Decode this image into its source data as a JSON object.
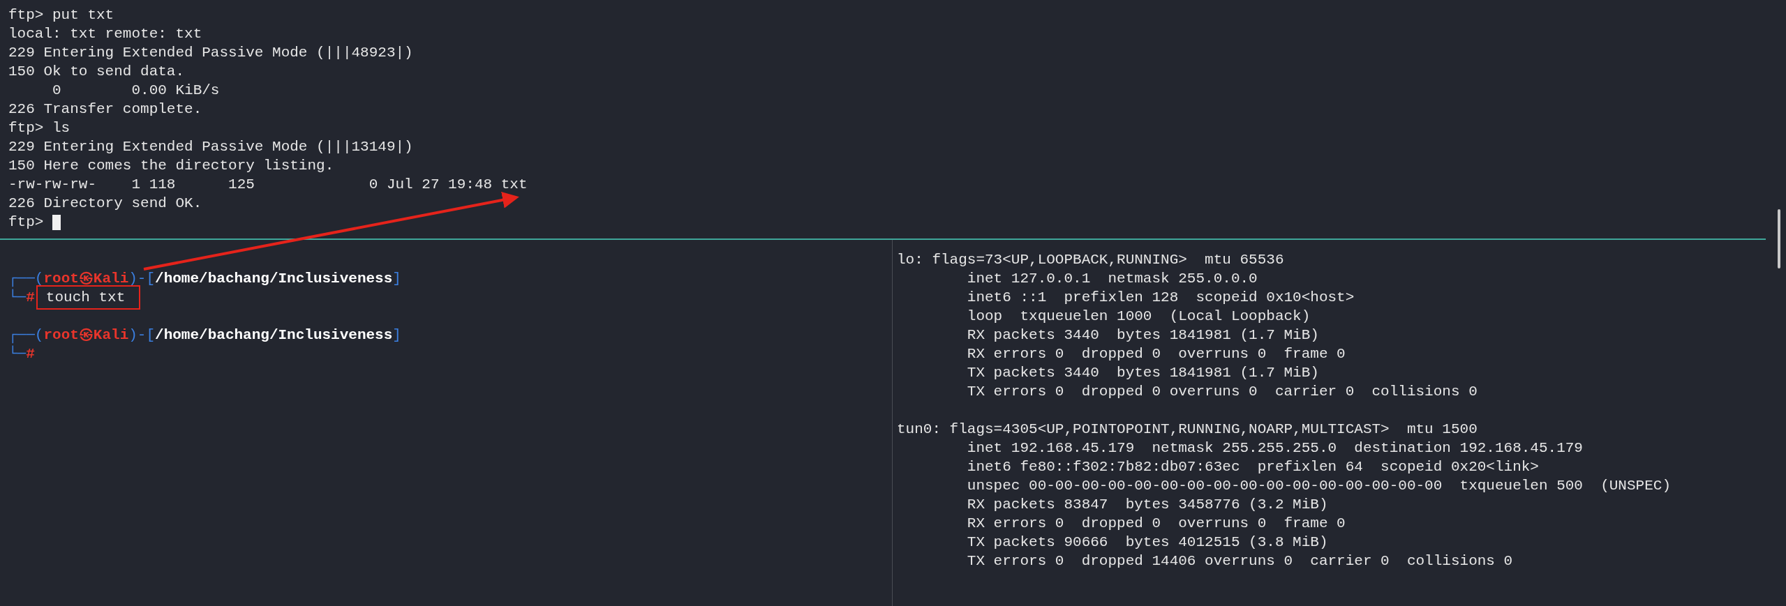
{
  "top_pane": {
    "lines": [
      "ftp> put txt",
      "local: txt remote: txt",
      "229 Entering Extended Passive Mode (|||48923|)",
      "150 Ok to send data.",
      "     0        0.00 KiB/s",
      "226 Transfer complete.",
      "ftp> ls",
      "229 Entering Extended Passive Mode (|||13149|)",
      "150 Here comes the directory listing.",
      "-rw-rw-rw-    1 118      125             0 Jul 27 19:48 txt",
      "226 Directory send OK.",
      "ftp> "
    ],
    "cursor": true
  },
  "left_pane": {
    "prompts": [
      {
        "corner_top": "┌──(",
        "user_host": "root㉿Kali",
        "bracket_open": ")-[",
        "path": "/home/bachang/Inclusiveness",
        "bracket_close": "]",
        "corner_bottom": "└─",
        "symbol": "#",
        "command": "touch txt",
        "annotated": true
      },
      {
        "corner_top": "┌──(",
        "user_host": "root㉿Kali",
        "bracket_open": ")-[",
        "path": "/home/bachang/Inclusiveness",
        "bracket_close": "]",
        "corner_bottom": "└─",
        "symbol": "#"
      }
    ]
  },
  "right_pane": {
    "blocks": [
      {
        "lines": [
          "lo: flags=73<UP,LOOPBACK,RUNNING>  mtu 65536",
          "        inet 127.0.0.1  netmask 255.0.0.0",
          "        inet6 ::1  prefixlen 128  scopeid 0x10<host>",
          "        loop  txqueuelen 1000  (Local Loopback)",
          "        RX packets 3440  bytes 1841981 (1.7 MiB)",
          "        RX errors 0  dropped 0  overruns 0  frame 0",
          "        TX packets 3440  bytes 1841981 (1.7 MiB)",
          "        TX errors 0  dropped 0 overruns 0  carrier 0  collisions 0"
        ]
      },
      {
        "lines": [
          "tun0: flags=4305<UP,POINTOPOINT,RUNNING,NOARP,MULTICAST>  mtu 1500",
          "        inet 192.168.45.179  netmask 255.255.255.0  destination 192.168.45.179",
          "        inet6 fe80::f302:7b82:db07:63ec  prefixlen 64  scopeid 0x20<link>",
          "        unspec 00-00-00-00-00-00-00-00-00-00-00-00-00-00-00-00  txqueuelen 500  (UNSPEC)",
          "        RX packets 83847  bytes 3458776 (3.2 MiB)",
          "        RX errors 0  dropped 0  overruns 0  frame 0",
          "        TX packets 90666  bytes 4012515 (3.8 MiB)",
          "        TX errors 0  dropped 14406 overruns 0  carrier 0  collisions 0"
        ]
      }
    ]
  }
}
